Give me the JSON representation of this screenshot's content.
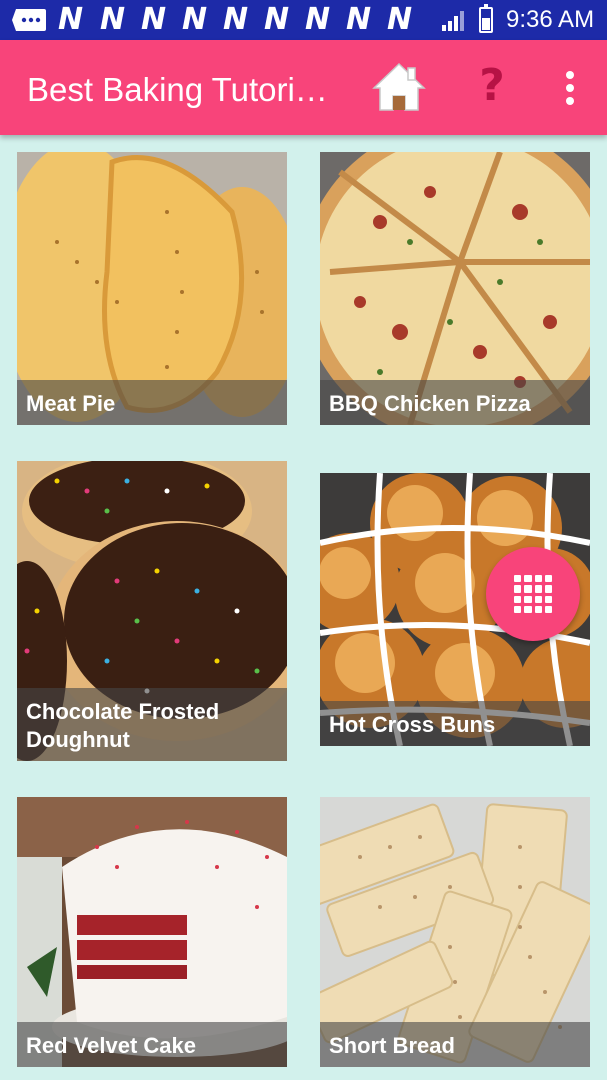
{
  "status_bar": {
    "notification_icons": [
      "message-icon",
      "n-notification-icon",
      "n-notification-icon",
      "n-notification-icon",
      "n-notification-icon",
      "n-notification-icon",
      "n-notification-icon",
      "n-notification-icon",
      "n-notification-icon"
    ],
    "n_glyph": "N",
    "time": "9:36 AM"
  },
  "app_bar": {
    "title": "Best Baking Tutori…",
    "icons": [
      "home-icon",
      "help-icon",
      "more-vert-icon"
    ],
    "help_glyph": "?"
  },
  "recipes": [
    {
      "name": "Meat Pie",
      "image": "meat-pie-photo"
    },
    {
      "name": "BBQ Chicken Pizza",
      "image": "bbq-chicken-pizza-photo"
    },
    {
      "name": "Chocolate Frosted Doughnut",
      "image": "chocolate-frosted-doughnut-photo"
    },
    {
      "name": "Hot Cross Buns",
      "image": "hot-cross-buns-photo"
    },
    {
      "name": "Red Velvet Cake",
      "image": "red-velvet-cake-photo"
    },
    {
      "name": "Short Bread",
      "image": "short-bread-photo"
    }
  ],
  "fab": {
    "icon": "apps-grid-icon"
  },
  "colors": {
    "status_bar": "#1d2aa8",
    "app_bar": "#f8447a",
    "background": "#d2f1ec",
    "help_icon": "#b61245"
  }
}
